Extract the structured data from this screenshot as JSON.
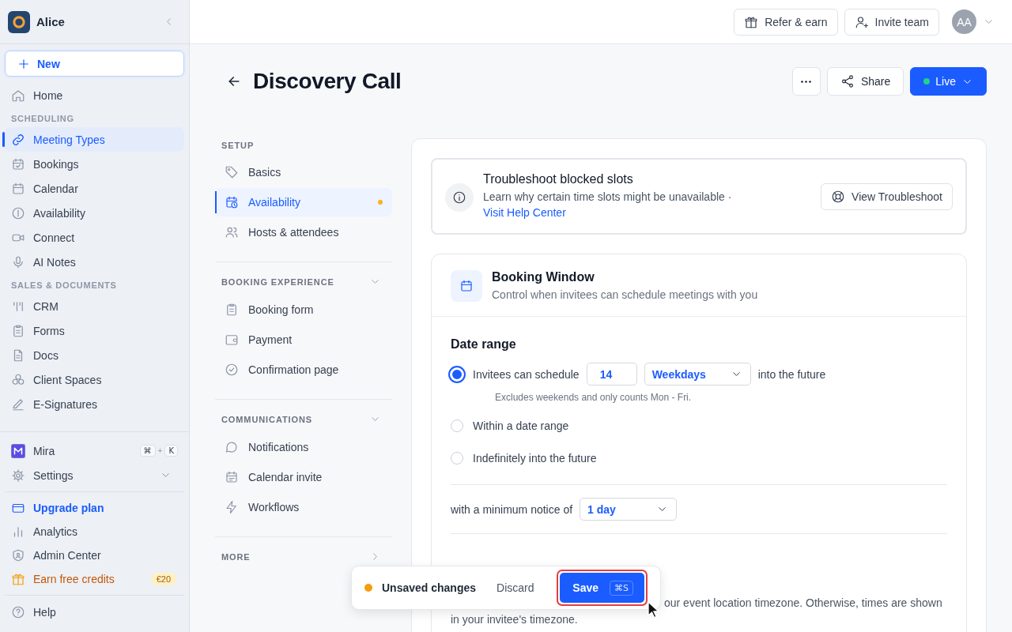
{
  "sidebar": {
    "workspace": "Alice",
    "new_button": "New",
    "sections": [
      {
        "items": [
          {
            "label": "Home",
            "selected": false
          }
        ]
      },
      {
        "heading": "SCHEDULING",
        "items": [
          {
            "label": "Meeting Types",
            "selected": true
          },
          {
            "label": "Bookings",
            "selected": false
          },
          {
            "label": "Calendar",
            "selected": false
          },
          {
            "label": "Availability",
            "selected": false
          },
          {
            "label": "Connect",
            "selected": false
          },
          {
            "label": "AI Notes",
            "selected": false
          }
        ]
      },
      {
        "heading": "SALES & DOCUMENTS",
        "items": [
          {
            "label": "CRM",
            "selected": false
          },
          {
            "label": "Forms",
            "selected": false
          },
          {
            "label": "Docs",
            "selected": false
          },
          {
            "label": "Client Spaces",
            "selected": false
          },
          {
            "label": "E-Signatures",
            "selected": false
          }
        ]
      }
    ],
    "assistant": {
      "label": "Mira",
      "shortcut": [
        "⌘",
        "+",
        "K"
      ]
    },
    "settings": {
      "label": "Settings",
      "expanded": false
    },
    "footer": [
      {
        "kind": "upgrade",
        "label": "Upgrade plan"
      },
      {
        "kind": "plain",
        "label": "Analytics"
      },
      {
        "kind": "plain",
        "label": "Admin Center"
      },
      {
        "kind": "promo",
        "label": "Earn free credits",
        "badge": "€20"
      }
    ],
    "help": "Help"
  },
  "topbar": {
    "refer": "Refer & earn",
    "invite": "Invite team",
    "avatar": "AA"
  },
  "page": {
    "title": "Discovery Call",
    "share": "Share",
    "status": {
      "label": "Live",
      "on": true
    }
  },
  "subnav": [
    {
      "heading": "SETUP",
      "items": [
        {
          "label": "Basics",
          "selected": false,
          "unsaved": false
        },
        {
          "label": "Availability",
          "selected": true,
          "unsaved": true
        },
        {
          "label": "Hosts & attendees",
          "selected": false,
          "unsaved": false
        }
      ]
    },
    {
      "heading": "BOOKING EXPERIENCE",
      "expanded": true,
      "items": [
        {
          "label": "Booking form",
          "selected": false,
          "unsaved": false
        },
        {
          "label": "Payment",
          "selected": false,
          "unsaved": false
        },
        {
          "label": "Confirmation page",
          "selected": false,
          "unsaved": false
        }
      ]
    },
    {
      "heading": "COMMUNICATIONS",
      "expanded": true,
      "items": [
        {
          "label": "Notifications",
          "selected": false,
          "unsaved": false
        },
        {
          "label": "Calendar invite",
          "selected": false,
          "unsaved": false
        },
        {
          "label": "Workflows",
          "selected": false,
          "unsaved": false
        }
      ]
    },
    {
      "heading": "MORE",
      "expanded": false
    }
  ],
  "troubleshoot": {
    "title": "Troubleshoot blocked slots",
    "text": "Learn why certain time slots might be unavailable ·",
    "link": "Visit Help Center",
    "button": "View Troubleshoot"
  },
  "booking_window": {
    "title": "Booking Window",
    "subtitle": "Control when invitees can schedule meetings with you",
    "section": "Date range",
    "options": [
      {
        "label": "Invitees can schedule",
        "selected": true,
        "count": "14",
        "unit": "Weekdays",
        "suffix": "into the future",
        "hint": "Excludes weekends and only counts Mon - Fri."
      },
      {
        "label": "Within a date range",
        "selected": false
      },
      {
        "label": "Indefinitely into the future",
        "selected": false
      }
    ],
    "notice_label": "with a minimum notice of",
    "notice_value": "1 day",
    "timezone_text": [
      "our event location timezone. Otherwise, times are shown",
      "in your invitee's timezone."
    ]
  },
  "toast": {
    "status": "Unsaved changes",
    "discard": "Discard",
    "save": "Save",
    "shortcut": "⌘S"
  }
}
